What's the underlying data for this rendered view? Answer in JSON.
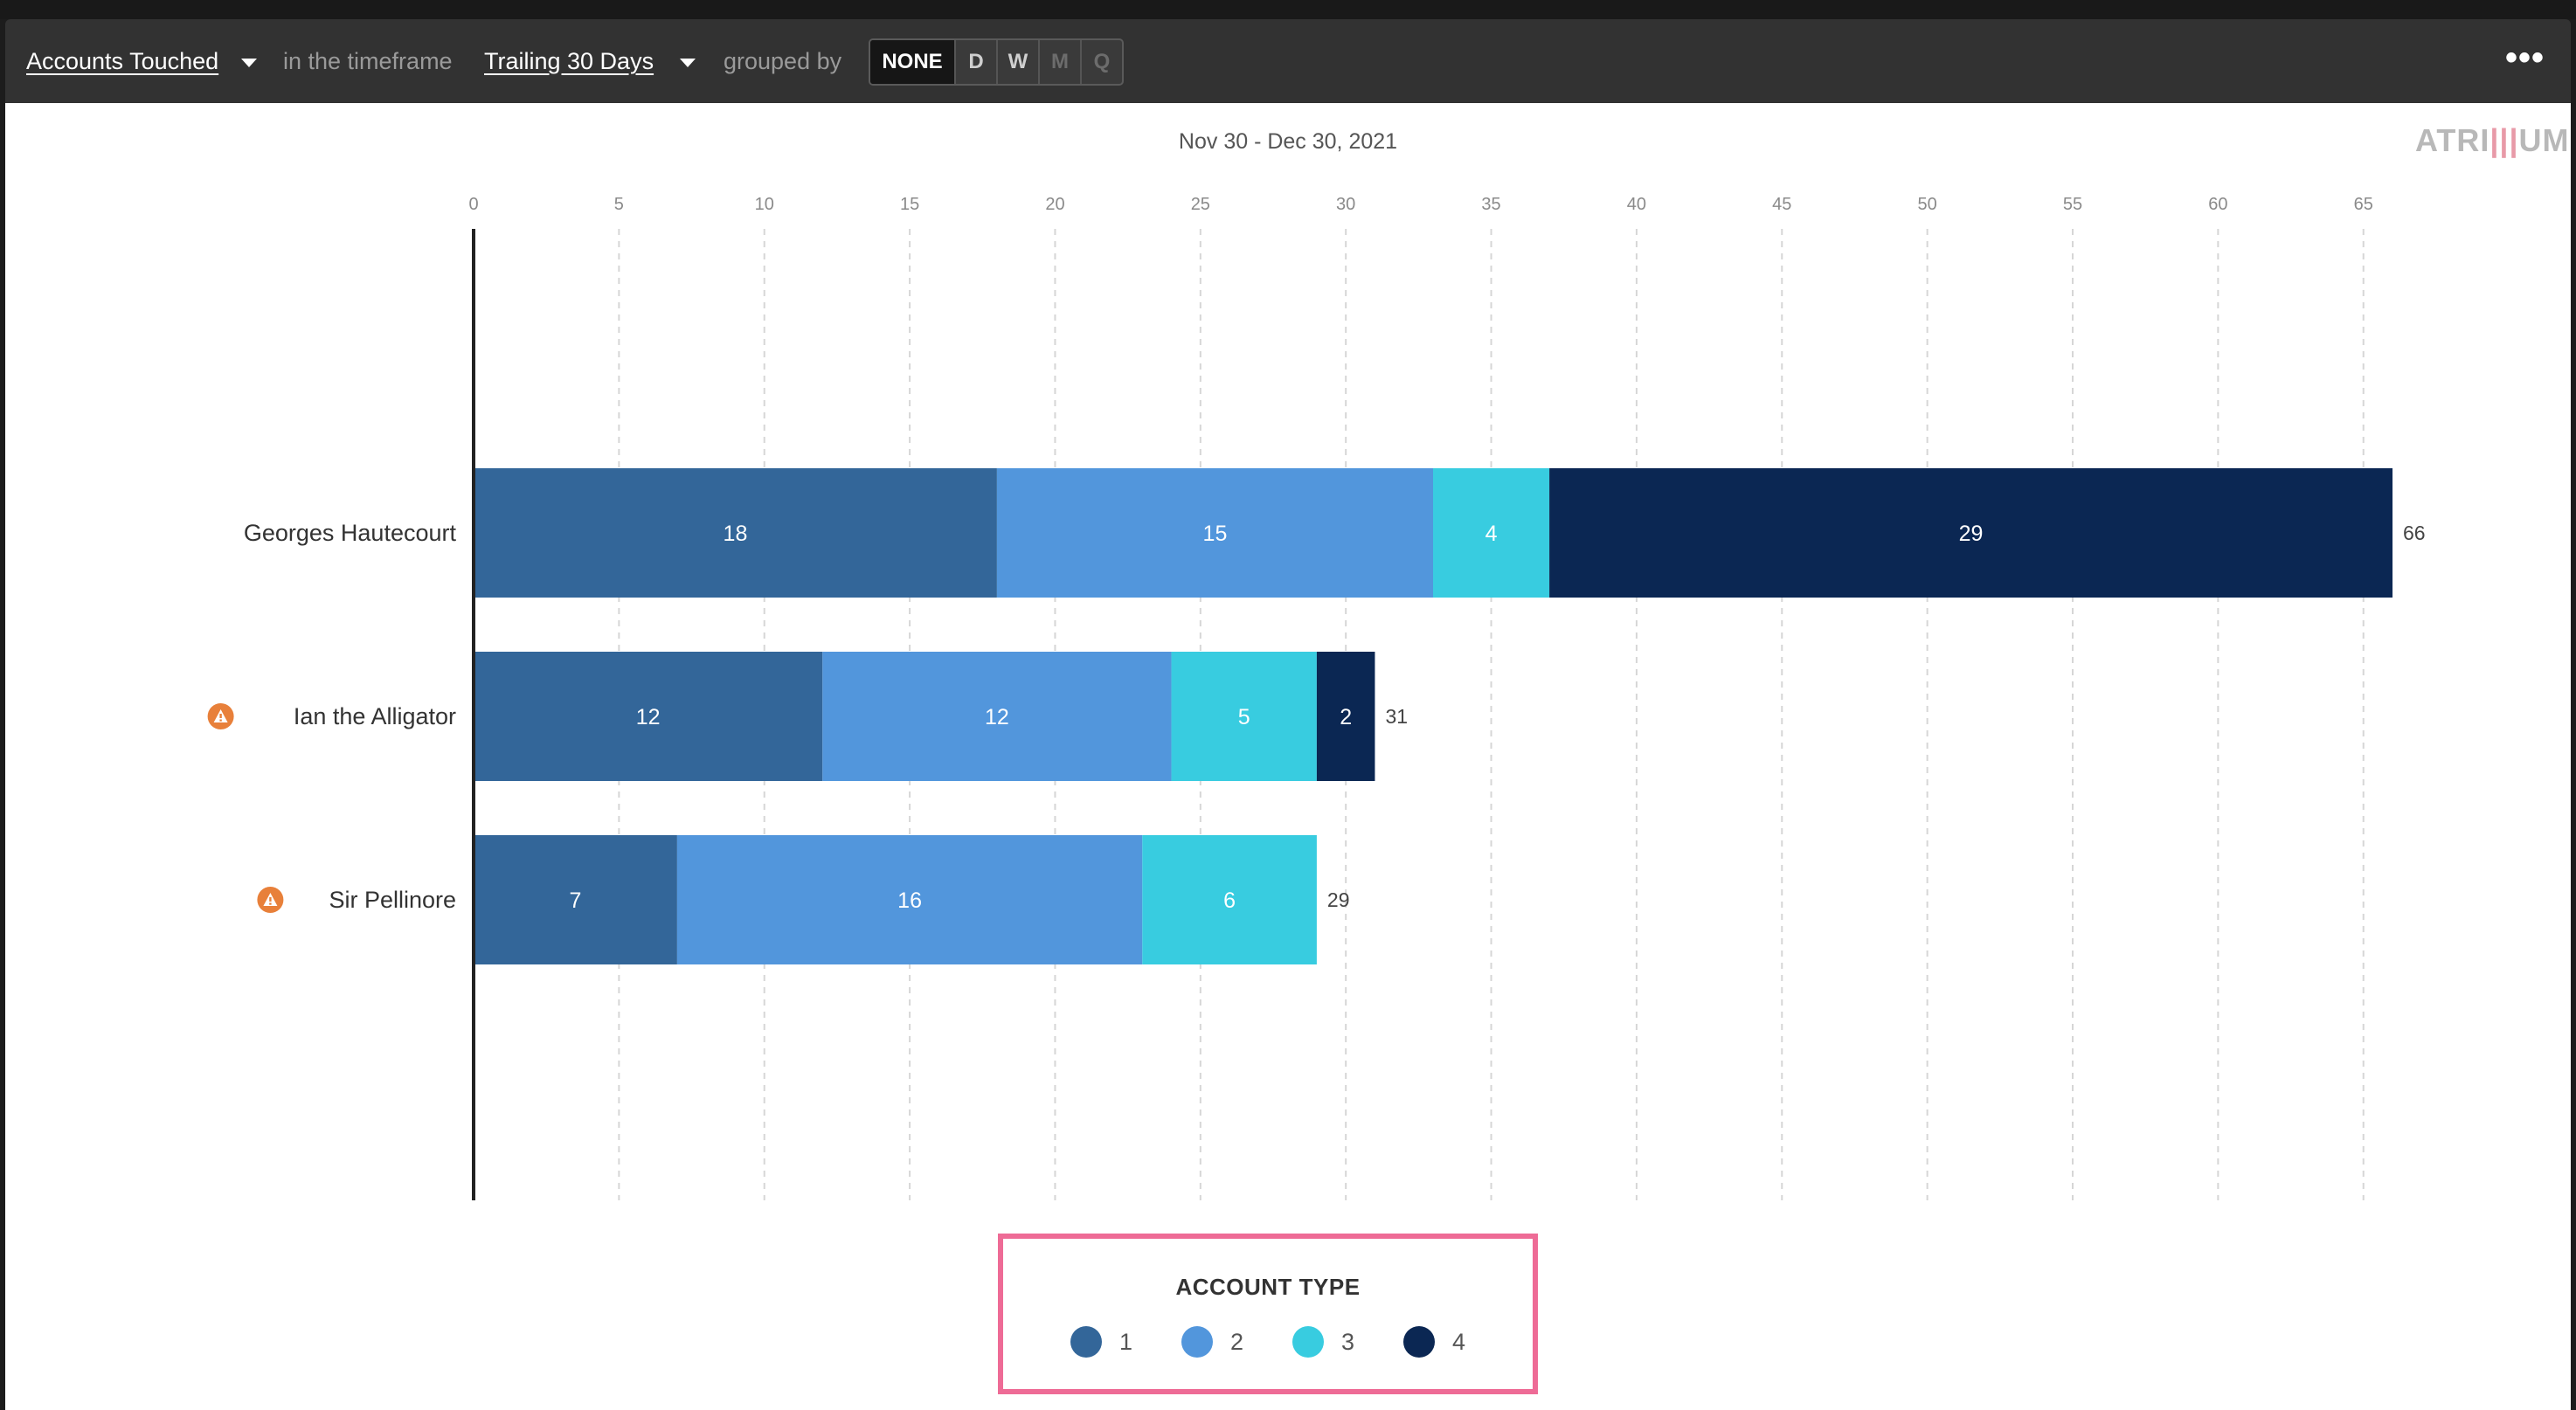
{
  "toolbar": {
    "metric_label": "Accounts Touched",
    "in_timeframe_text": "in the timeframe",
    "timeframe_label": "Trailing 30 Days",
    "grouped_by_text": "grouped by",
    "grouping_options": [
      "NONE",
      "D",
      "W",
      "M",
      "Q"
    ],
    "grouping_selected": "NONE",
    "more_label": "•••"
  },
  "logo": {
    "text_left": "ATRI",
    "text_mark": "|||",
    "text_right": "UM"
  },
  "chart_data": {
    "type": "bar",
    "orientation": "horizontal",
    "stacked": true,
    "title": "Nov 30 - Dec 30, 2021",
    "categories": [
      "Georges Hautecourt",
      "Ian the Alligator",
      "Sir Pellinore"
    ],
    "warning_flags": [
      false,
      true,
      true
    ],
    "series": [
      {
        "name": "1",
        "values": [
          18,
          12,
          7
        ],
        "color": "#336699"
      },
      {
        "name": "2",
        "values": [
          15,
          12,
          16
        ],
        "color": "#5296dc"
      },
      {
        "name": "3",
        "values": [
          4,
          5,
          6
        ],
        "color": "#38cce0"
      },
      {
        "name": "4",
        "values": [
          29,
          2,
          0
        ],
        "color": "#0b2753"
      }
    ],
    "totals": [
      66,
      31,
      29
    ],
    "xlim": [
      0,
      66
    ],
    "x_ticks": [
      0,
      5,
      10,
      15,
      20,
      25,
      30,
      35,
      40,
      45,
      50,
      55,
      60,
      65
    ],
    "grid": true,
    "tick_position": "top",
    "legend": {
      "title": "ACCOUNT TYPE",
      "position": "bottom-center"
    }
  }
}
